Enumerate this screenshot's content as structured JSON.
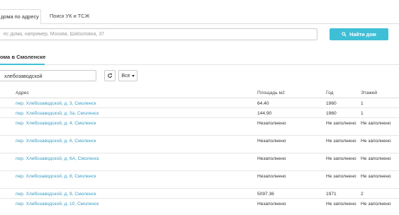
{
  "tabs": [
    {
      "label": "дома по адресу"
    },
    {
      "label": "Поиск УК и ТСЖ"
    }
  ],
  "search": {
    "placeholder": "ес дома, например, Москва, Шаболовка, 37",
    "button_label": "Найти дом"
  },
  "section": {
    "title": "ома в Смоленске"
  },
  "filter": {
    "value": "хлебозаводской",
    "dropdown_label": "Все"
  },
  "table": {
    "headers": [
      "Адрес",
      "Площадь м2",
      "Год",
      "Этажей"
    ],
    "rows": [
      {
        "address": "пер. Хлебозаводской, д. 3, Смоленск",
        "area": "64.40",
        "year": "1960",
        "floors": "1"
      },
      {
        "address": "пер. Хлебозаводской, д. 3а, Смоленск",
        "area": "144.90",
        "year": "1960",
        "floors": "1"
      },
      {
        "address": "пер. Хлебозаводской, д. 4, Смоленск",
        "area": "Незаполнено",
        "year": "Не заполнено",
        "floors": "Не заполнено"
      },
      {
        "address": "пер. Хлебозаводской, д. 6, Смоленск",
        "area": "Незаполнено",
        "year": "Не заполнено",
        "floors": "Не заполнено"
      },
      {
        "address": "пер. Хлебозаводской, д. 6А, Смоленск",
        "area": "Незаполнено",
        "year": "Не заполнено",
        "floors": "Не заполнено"
      },
      {
        "address": "пер. Хлебозаводской, д. 8, Смоленск",
        "area": "Незаполнено",
        "year": "Не заполнено",
        "floors": "Не заполнено"
      },
      {
        "address": "пер. Хлебозаводской, д. 9, Смоленск",
        "area": "5097.36",
        "year": "1971",
        "floors": "2"
      },
      {
        "address": "пер. Хлебозаводской, д. 10, Смоленск",
        "area": "Незаполнено",
        "year": "Не заполнено",
        "floors": "Не заполнено"
      }
    ]
  },
  "icons": {
    "search": "search-icon",
    "refresh": "refresh-icon",
    "caret": "caret-down-icon"
  },
  "colors": {
    "accent": "#3fbfd6",
    "link": "#3b9dc4"
  }
}
